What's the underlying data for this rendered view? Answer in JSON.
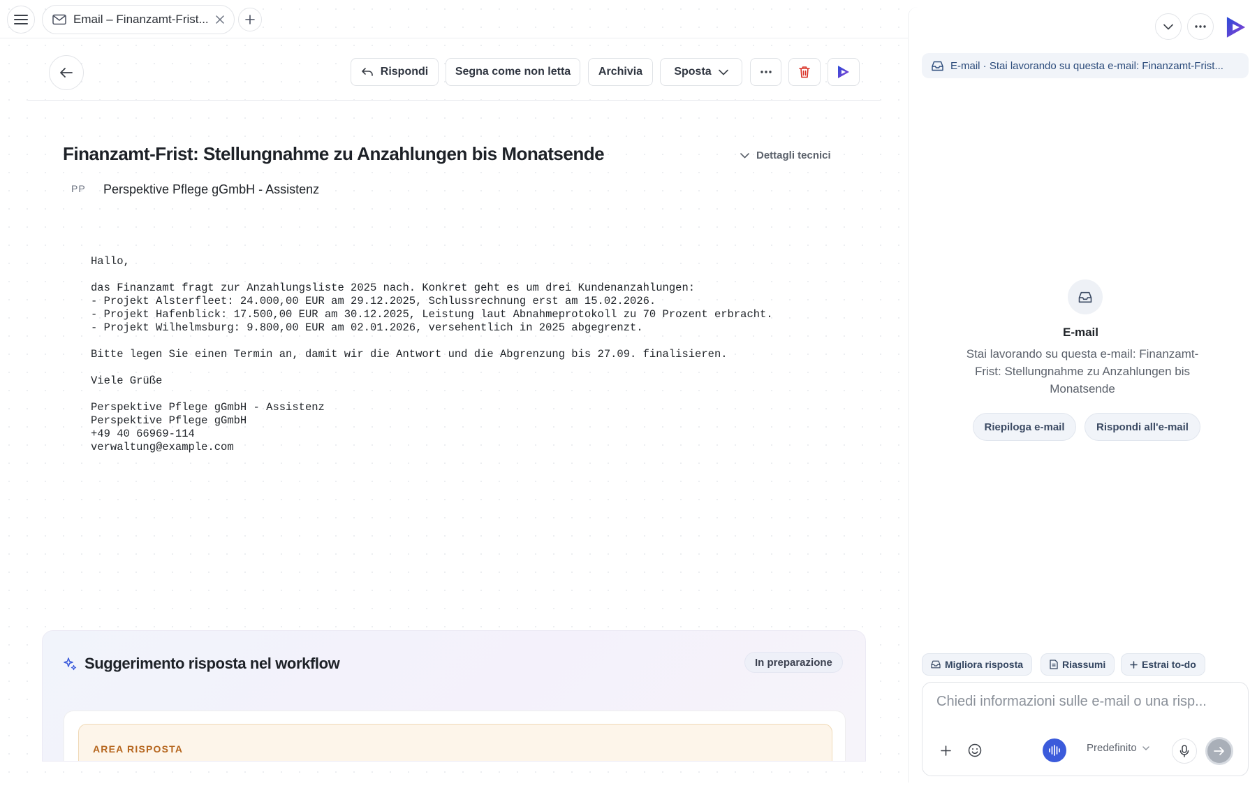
{
  "tabbar": {
    "tab_title": "Email – Finanzamt-Frist..."
  },
  "toolbar": {
    "reply_label": "Rispondi",
    "mark_unread_label": "Segna come non letta",
    "archive_label": "Archivia",
    "move_label": "Sposta"
  },
  "email": {
    "subject": "Finanzamt-Frist: Stellungnahme zu Anzahlungen bis Monatsende",
    "details_label": "Dettagli tecnici",
    "sender_initials": "PP",
    "sender_name": "Perspektive Pflege gGmbH - Assistenz",
    "body": {
      "greeting": "Hallo,",
      "intro": "das Finanzamt fragt zur Anzahlungsliste 2025 nach. Konkret geht es um drei Kundenanzahlungen:",
      "item1": "- Projekt Alsterfleet: 24.000,00 EUR am 29.12.2025, Schlussrechnung erst am 15.02.2026.",
      "item2": "- Projekt Hafenblick: 17.500,00 EUR am 30.12.2025, Leistung laut Abnahmeprotokoll zu 70 Prozent erbracht.",
      "item3": "- Projekt Wilhelmsburg: 9.800,00 EUR am 02.01.2026, versehentlich in 2025 abgegrenzt.",
      "request": "Bitte legen Sie einen Termin an, damit wir die Antwort und die Abgrenzung bis 27.09. finalisieren.",
      "closing": "Viele Grüße",
      "sig_name": "Perspektive Pflege gGmbH - Assistenz",
      "sig_company": "Perspektive Pflege gGmbH",
      "sig_phone": "+49 40 66969-114",
      "sig_email": "verwaltung@example.com"
    }
  },
  "suggestion": {
    "title": "Suggerimento risposta nel workflow",
    "status": "In preparazione",
    "area_label": "AREA RISPOSTA"
  },
  "assistant": {
    "context_chip": "E-mail · Stai lavorando su questa e-mail: Finanzamt-Frist...",
    "empty_title": "E-mail",
    "empty_desc": "Stai lavorando su questa e-mail: Finanzamt-Frist: Stellungnahme zu Anzahlungen bis Monatsende",
    "summarize_button": "Riepiloga e-mail",
    "reply_button": "Rispondi all'e-mail",
    "quick_actions": [
      "Migliora risposta",
      "Riassumi",
      "Estrai to-do"
    ],
    "composer_placeholder": "Chiedi informazioni sulle e-mail o una risp...",
    "model_label": "Predefinito"
  },
  "colors": {
    "delete": "#d93025",
    "brand_blue": "#2b4cd8",
    "brand_purple": "#8a3fd1"
  },
  "icons": [
    "menu-icon",
    "mail-icon",
    "close-icon",
    "plus-icon",
    "arrow-left-icon",
    "reply-icon",
    "chevron-down-icon",
    "more-icon",
    "trash-icon",
    "brand-logo-icon",
    "inbox-icon",
    "sparkle-icon",
    "document-icon",
    "emoji-icon",
    "voice-wave-icon",
    "microphone-icon",
    "send-icon"
  ]
}
